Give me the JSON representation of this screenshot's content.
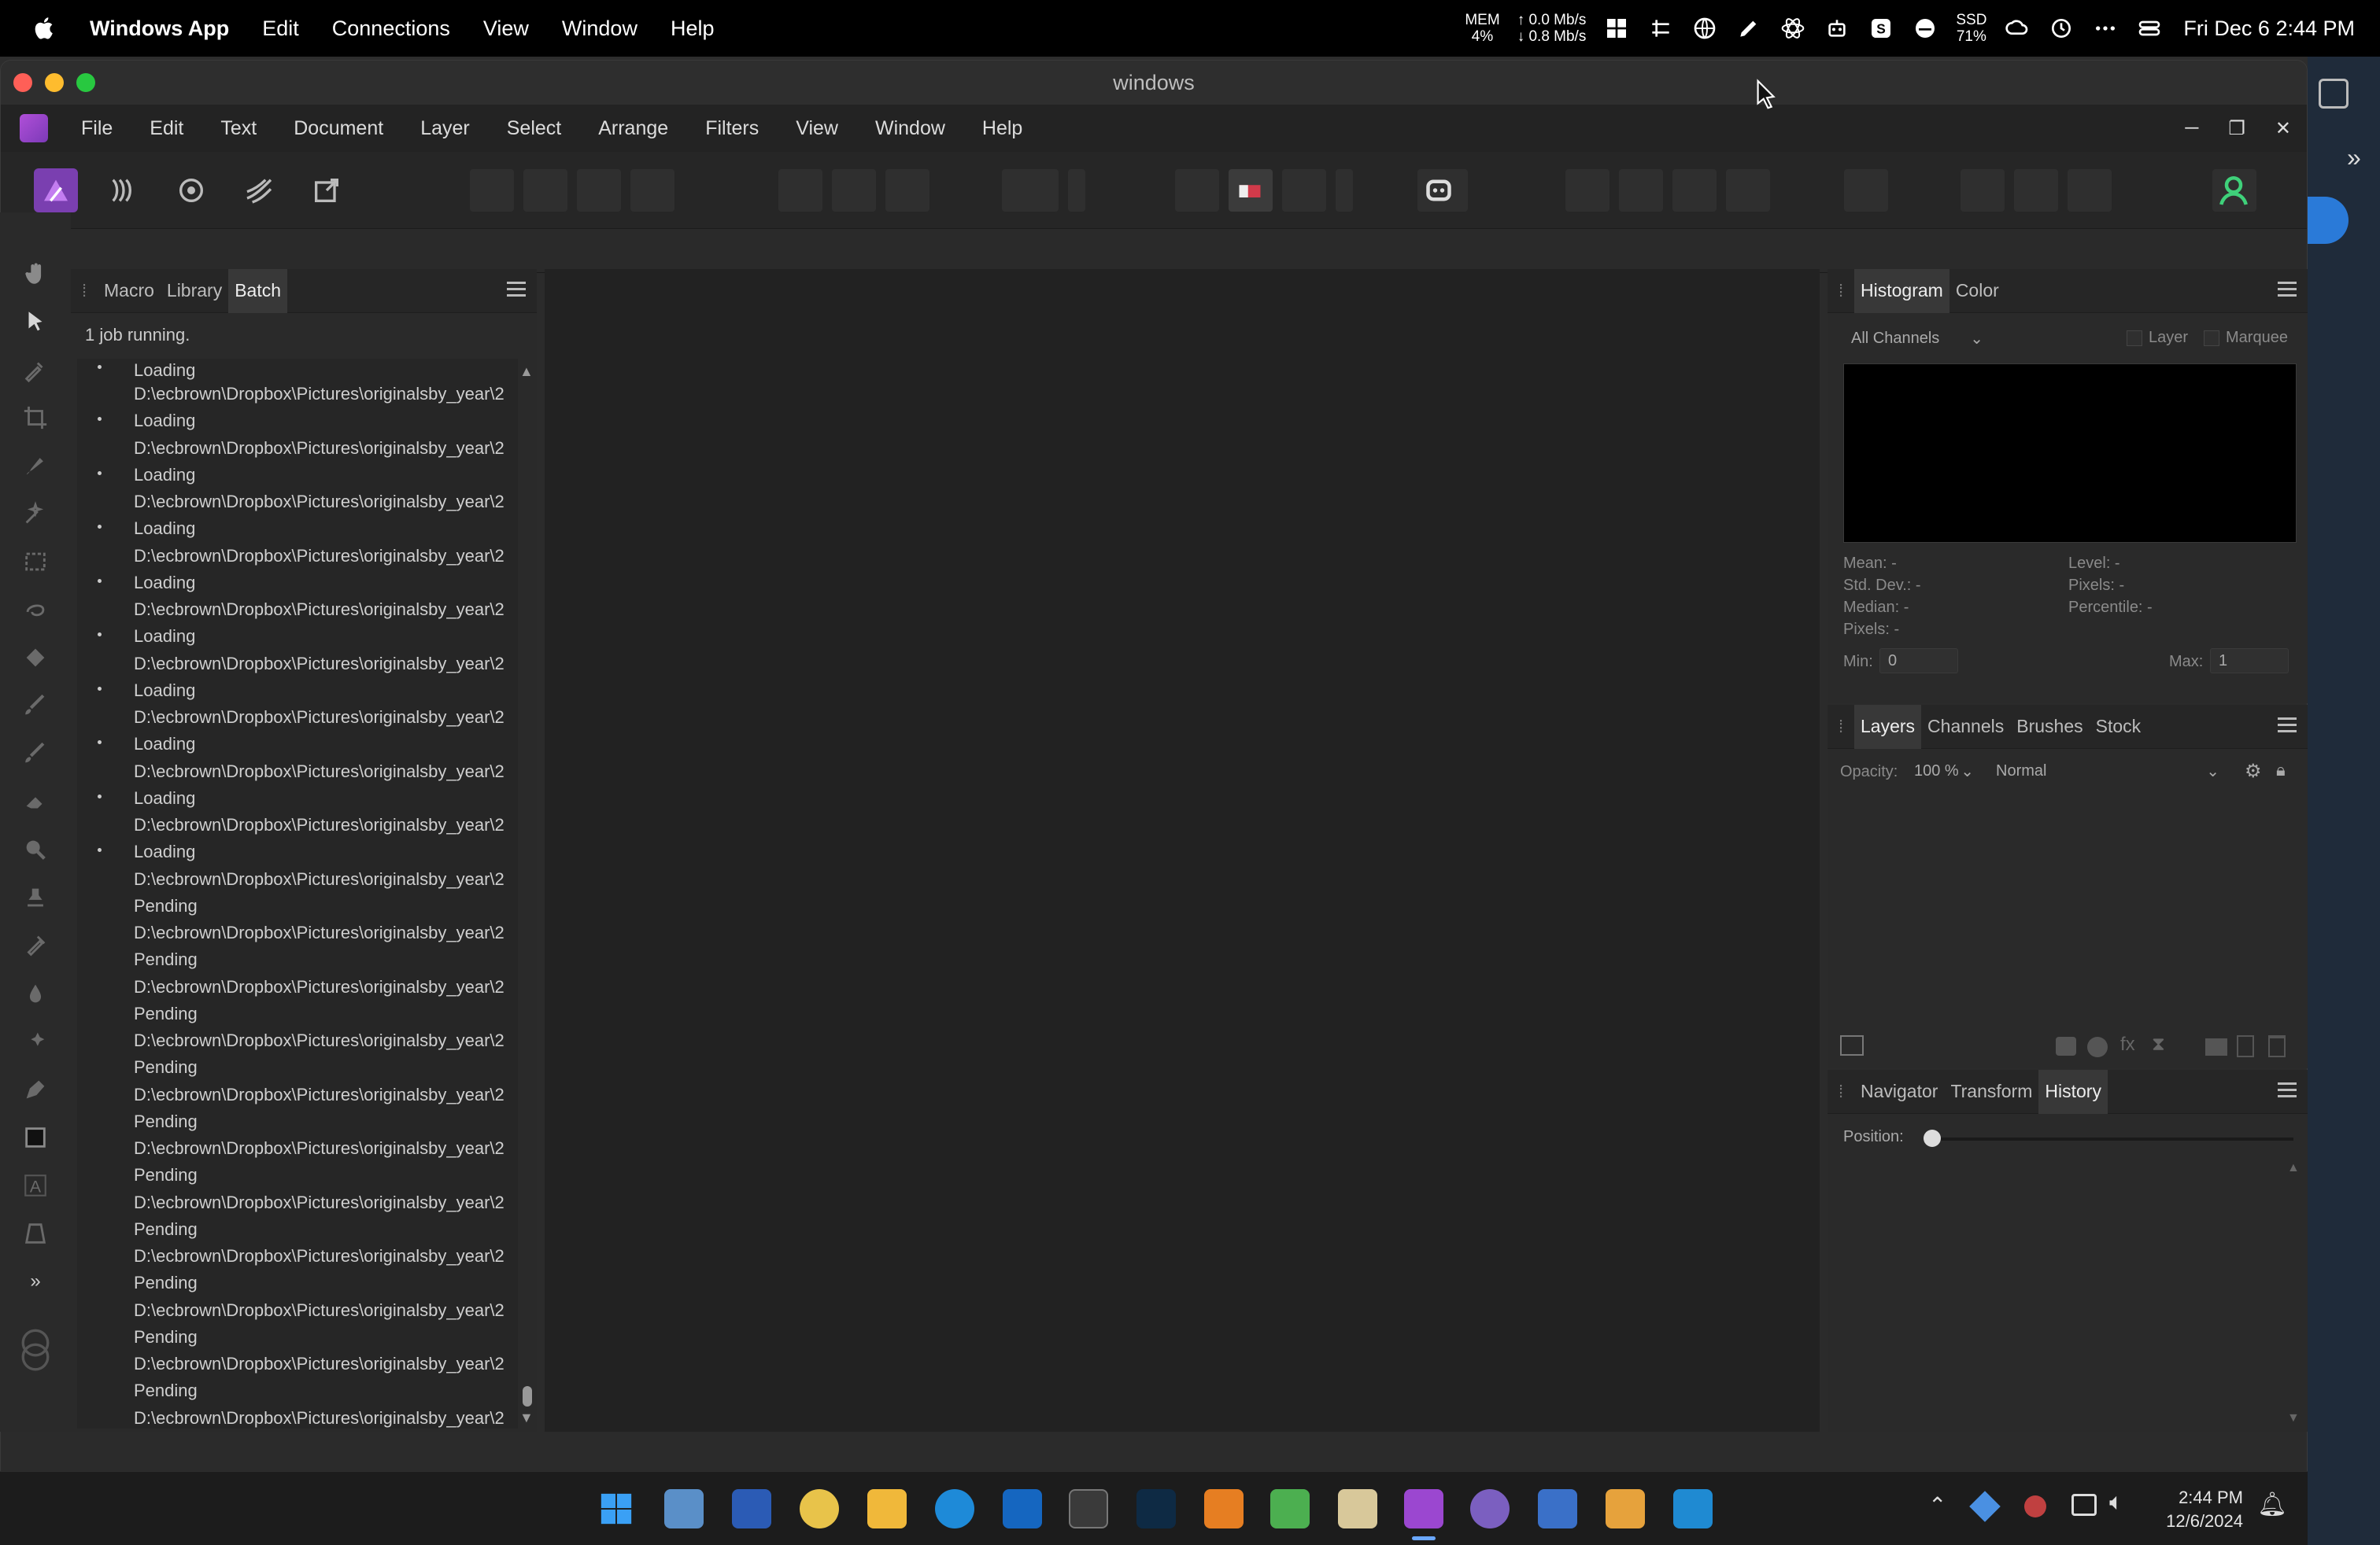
{
  "mac_menubar": {
    "app_name": "Windows App",
    "items": [
      "Edit",
      "Connections",
      "View",
      "Window",
      "Help"
    ],
    "mem_label": "MEM",
    "mem_value": "4%",
    "net_up": "0.0 Mb/s",
    "net_down": "0.8 Mb/s",
    "ssd_label": "SSD",
    "ssd_value": "71%",
    "clock": "Fri Dec 6  2:44 PM"
  },
  "window": {
    "title": "windows"
  },
  "app_menu": {
    "items": [
      "File",
      "Edit",
      "Text",
      "Document",
      "Layer",
      "Select",
      "Arrange",
      "Filters",
      "View",
      "Window",
      "Help"
    ]
  },
  "batch_panel": {
    "tabs": [
      "Macro",
      "Library",
      "Batch"
    ],
    "active_tab": "Batch",
    "job_status": "1 job running.",
    "first_status": "Loading",
    "jobs": [
      {
        "path": "D:\\ecbrown\\Dropbox\\Pictures\\originalsby_year\\2",
        "status": "Loading"
      },
      {
        "path": "D:\\ecbrown\\Dropbox\\Pictures\\originalsby_year\\2",
        "status": "Loading"
      },
      {
        "path": "D:\\ecbrown\\Dropbox\\Pictures\\originalsby_year\\2",
        "status": "Loading"
      },
      {
        "path": "D:\\ecbrown\\Dropbox\\Pictures\\originalsby_year\\2",
        "status": "Loading"
      },
      {
        "path": "D:\\ecbrown\\Dropbox\\Pictures\\originalsby_year\\2",
        "status": "Loading"
      },
      {
        "path": "D:\\ecbrown\\Dropbox\\Pictures\\originalsby_year\\2",
        "status": "Loading"
      },
      {
        "path": "D:\\ecbrown\\Dropbox\\Pictures\\originalsby_year\\2",
        "status": "Loading"
      },
      {
        "path": "D:\\ecbrown\\Dropbox\\Pictures\\originalsby_year\\2",
        "status": "Loading"
      },
      {
        "path": "D:\\ecbrown\\Dropbox\\Pictures\\originalsby_year\\2",
        "status": "Loading"
      },
      {
        "path": "D:\\ecbrown\\Dropbox\\Pictures\\originalsby_year\\2",
        "status": "Pending"
      },
      {
        "path": "D:\\ecbrown\\Dropbox\\Pictures\\originalsby_year\\2",
        "status": "Pending"
      },
      {
        "path": "D:\\ecbrown\\Dropbox\\Pictures\\originalsby_year\\2",
        "status": "Pending"
      },
      {
        "path": "D:\\ecbrown\\Dropbox\\Pictures\\originalsby_year\\2",
        "status": "Pending"
      },
      {
        "path": "D:\\ecbrown\\Dropbox\\Pictures\\originalsby_year\\2",
        "status": "Pending"
      },
      {
        "path": "D:\\ecbrown\\Dropbox\\Pictures\\originalsby_year\\2",
        "status": "Pending"
      },
      {
        "path": "D:\\ecbrown\\Dropbox\\Pictures\\originalsby_year\\2",
        "status": "Pending"
      },
      {
        "path": "D:\\ecbrown\\Dropbox\\Pictures\\originalsby_year\\2",
        "status": "Pending"
      },
      {
        "path": "D:\\ecbrown\\Dropbox\\Pictures\\originalsby_year\\2",
        "status": "Pending"
      },
      {
        "path": "D:\\ecbrown\\Dropbox\\Pictures\\originalsby_year\\2",
        "status": "Pending"
      },
      {
        "path": "D:\\ecbrown\\Dropbox\\Pictures\\originalsby_year\\2",
        "status": "Pending"
      }
    ]
  },
  "histogram_panel": {
    "tabs": [
      "Histogram",
      "Color"
    ],
    "active_tab": "Histogram",
    "channel_select": "All Channels",
    "layer_check": "Layer",
    "marquee_check": "Marquee",
    "stats_left": [
      "Mean: -",
      "Std. Dev.: -",
      "Median: -",
      "Pixels: -"
    ],
    "stats_right": [
      "Level: -",
      "Pixels: -",
      "Percentile: -"
    ],
    "min_label": "Min:",
    "min_value": "0",
    "max_label": "Max:",
    "max_value": "1"
  },
  "layers_panel": {
    "tabs": [
      "Layers",
      "Channels",
      "Brushes",
      "Stock"
    ],
    "active_tab": "Layers",
    "opacity_label": "Opacity:",
    "opacity_value": "100 %",
    "blend_mode": "Normal"
  },
  "history_panel": {
    "tabs": [
      "Navigator",
      "Transform",
      "History"
    ],
    "active_tab": "History",
    "position_label": "Position:"
  },
  "taskbar": {
    "time": "2:44 PM",
    "date": "12/6/2024"
  },
  "colors": {
    "accent_purple": "#9b47d0",
    "window_bg": "#2b2b2b",
    "canvas_bg": "#222222"
  }
}
